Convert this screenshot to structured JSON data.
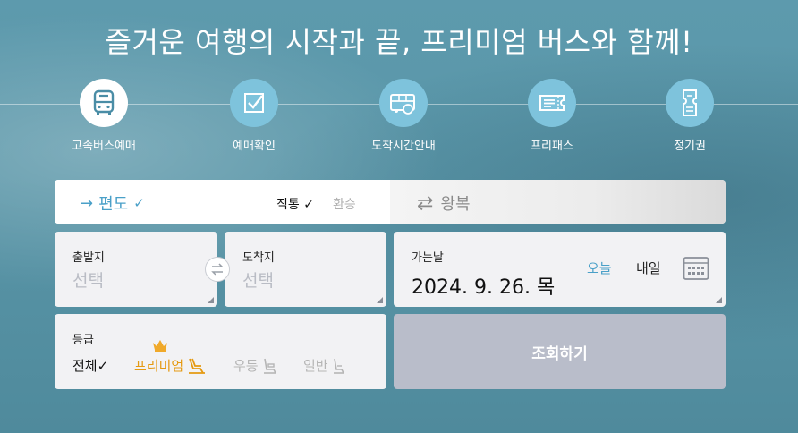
{
  "hero": {
    "title": "즐거운 여행의 시작과 끝, 프리미엄 버스와 함께!"
  },
  "menu": {
    "items": [
      {
        "label": "고속버스예매",
        "icon": "bus-icon",
        "active": true
      },
      {
        "label": "예매확인",
        "icon": "checkbox-icon",
        "active": false
      },
      {
        "label": "도착시간안내",
        "icon": "bus-time-icon",
        "active": false
      },
      {
        "label": "프리패스",
        "icon": "ticket-icon",
        "active": false
      },
      {
        "label": "정기권",
        "icon": "season-pass-icon",
        "active": false
      }
    ]
  },
  "trip": {
    "oneway_label": "편도",
    "oneway_arrow": "→",
    "check": "✓",
    "direct_label": "직통",
    "transfer_label": "환승",
    "round_label": "왕복",
    "round_icon": "⇄"
  },
  "route": {
    "departure_caption": "출발지",
    "departure_placeholder": "선택",
    "arrival_caption": "도착지",
    "arrival_placeholder": "선택"
  },
  "date": {
    "caption": "가는날",
    "value": "2024. 9. 26. 목",
    "today_label": "오늘",
    "tomorrow_label": "내일"
  },
  "grade": {
    "caption": "등급",
    "all_label": "전체",
    "premium_label": "프리미엄",
    "first_label": "우등",
    "normal_label": "일반"
  },
  "search": {
    "label": "조회하기"
  },
  "colors": {
    "accent": "#4aa0c8",
    "premium": "#e59a12",
    "button_disabled": "#b9bdca"
  }
}
